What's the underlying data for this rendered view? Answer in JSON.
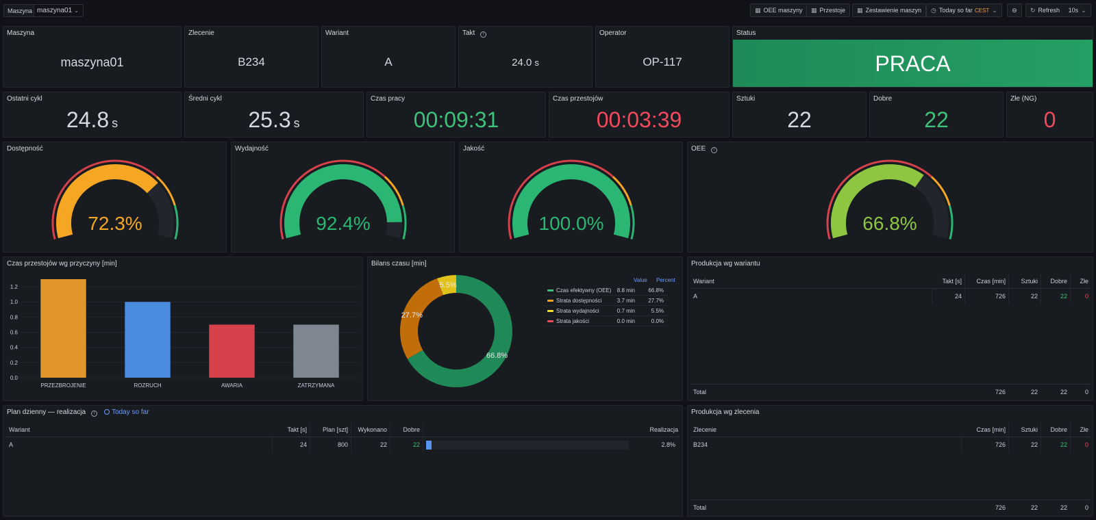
{
  "toolbar": {
    "var_label": "Maszyna",
    "var_value": "maszyna01",
    "btn_oee": "OEE maszyny",
    "btn_downtime": "Przestoje",
    "btn_summary": "Zestawienie maszyn",
    "time_range": "Today so far",
    "timezone": "CEST",
    "refresh": "Refresh",
    "refresh_interval": "10s"
  },
  "stats_row1": {
    "machine": {
      "title": "Maszyna",
      "value": "maszyna01"
    },
    "order": {
      "title": "Zlecenie",
      "value": "B234"
    },
    "variant": {
      "title": "Wariant",
      "value": "A"
    },
    "takt": {
      "title": "Takt",
      "value": "24.0",
      "unit": "s"
    },
    "operator": {
      "title": "Operator",
      "value": "OP-117"
    },
    "status": {
      "title": "Status",
      "value": "PRACA"
    }
  },
  "stats_row2": {
    "last_cycle": {
      "title": "Ostatni cykl",
      "value": "24.8",
      "unit": "s"
    },
    "avg_cycle": {
      "title": "Średni cykl",
      "value": "25.3",
      "unit": "s"
    },
    "work_time": {
      "title": "Czas pracy",
      "value": "00:09:31"
    },
    "downtime": {
      "title": "Czas przestojów",
      "value": "00:03:39"
    },
    "pieces": {
      "title": "Sztuki",
      "value": "22"
    },
    "good": {
      "title": "Dobre",
      "value": "22"
    },
    "bad": {
      "title": "Złe (NG)",
      "value": "0"
    }
  },
  "gauges": [
    {
      "title": "Dostępność",
      "value": 72.3,
      "label": "72.3%",
      "color": "#f5a623"
    },
    {
      "title": "Wydajność",
      "value": 92.4,
      "label": "92.4%",
      "color": "#2bb673"
    },
    {
      "title": "Jakość",
      "value": 100.0,
      "label": "100.0%",
      "color": "#2bb673"
    },
    {
      "title": "OEE",
      "value": 66.8,
      "label": "66.8%",
      "color": "#8fc641"
    }
  ],
  "colors": {
    "green": "#3ec178",
    "red": "#f2495c",
    "orange": "#f5a623",
    "yellow": "#fade2a",
    "blue": "#5794f2",
    "panel_bg": "#181b1f",
    "page_bg": "#111217"
  },
  "downtime_chart": {
    "title": "Czas przestojów wg przyczyny [min]",
    "chart_data": {
      "type": "bar",
      "categories": [
        "PRZEZBROJENIE",
        "ROZRUCH",
        "AWARIA",
        "ZATRZYMANA"
      ],
      "values": [
        1.3,
        1.0,
        0.7,
        0.7
      ],
      "colors": [
        "#e0962a",
        "#4a8de0",
        "#d6414c",
        "#7d8691"
      ],
      "ylim": [
        0,
        1.3
      ],
      "yticks": [
        "0.0",
        "0.2",
        "0.4",
        "0.6",
        "0.8",
        "1.0",
        "1.2"
      ],
      "grid": true
    }
  },
  "balance_chart": {
    "title": "Bilans czasu [min]",
    "legend_value_header": "Value",
    "legend_percent_header": "Percent",
    "chart_data": {
      "type": "pie",
      "series": [
        {
          "name": "Czas efektywny (OEE)",
          "value": 8.8,
          "value_label": "8.8 min",
          "percent": 66.8,
          "percent_label": "66.8%",
          "color": "#1f8a57"
        },
        {
          "name": "Strata dostępności",
          "value": 3.7,
          "value_label": "3.7 min",
          "percent": 27.7,
          "percent_label": "27.7%",
          "color": "#c06d0a"
        },
        {
          "name": "Strata wydajności",
          "value": 0.7,
          "value_label": "0.7 min",
          "percent": 5.5,
          "percent_label": "5.5%",
          "color": "#e0c21a"
        },
        {
          "name": "Strata jakości",
          "value": 0.0,
          "value_label": "0.0 min",
          "percent": 0.0,
          "percent_label": "0.0%",
          "color": "#d6414c"
        }
      ],
      "legend": "right"
    }
  },
  "variant_table": {
    "title": "Produkcja wg wariantu",
    "headers": [
      "Wariant",
      "Takt [s]",
      "Czas [min]",
      "Sztuki",
      "Dobre",
      "Złe"
    ],
    "rows": [
      [
        "A",
        "24",
        "726",
        "22",
        "22",
        "0"
      ]
    ],
    "total": [
      "Total",
      "726",
      "22",
      "22",
      "0"
    ]
  },
  "plan_table": {
    "title": "Plan dzienny — realizacja",
    "time_link": "Today so far",
    "headers": [
      "Wariant",
      "Takt [s]",
      "Plan [szt]",
      "Wykonano",
      "Dobre",
      "Realizacja"
    ],
    "rows": [
      {
        "variant": "A",
        "takt": "24",
        "plan": "800",
        "done": "22",
        "good": "22",
        "progress": 0.028,
        "progress_label": "2.8%"
      }
    ]
  },
  "order_table": {
    "title": "Produkcja wg zlecenia",
    "headers": [
      "Zlecenie",
      "Czas [min]",
      "Sztuki",
      "Dobre",
      "Złe"
    ],
    "rows": [
      [
        "B234",
        "726",
        "22",
        "22",
        "0"
      ]
    ],
    "total": [
      "Total",
      "726",
      "22",
      "22",
      "0"
    ]
  }
}
